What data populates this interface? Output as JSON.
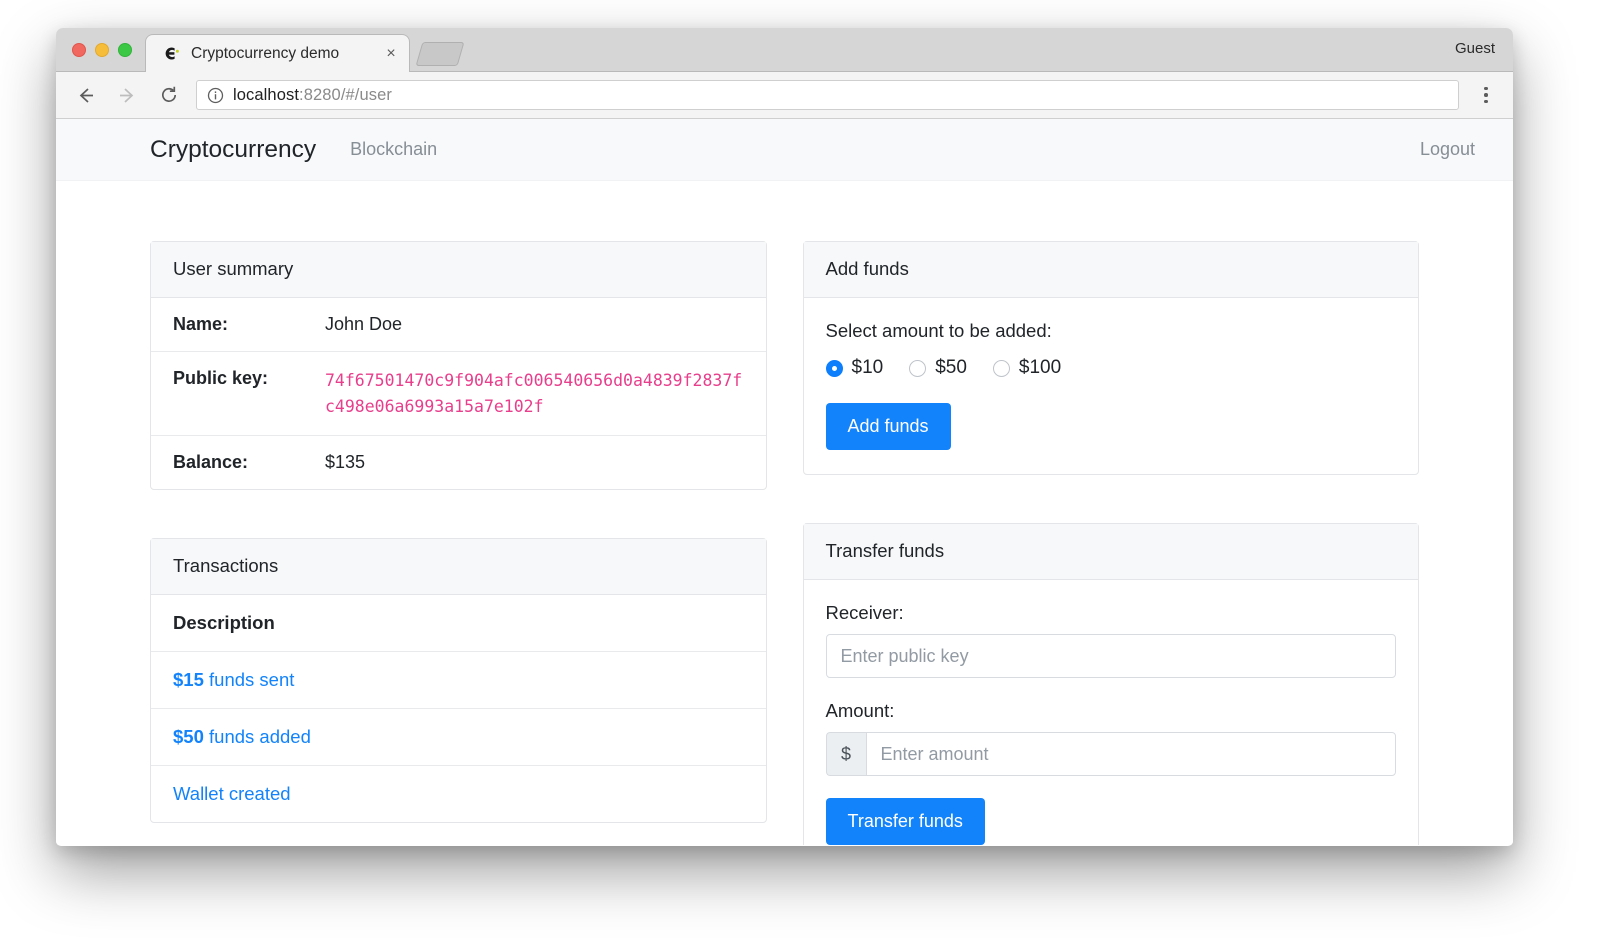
{
  "browser": {
    "tab_title": "Cryptocurrency demo",
    "favicon": "coin-c-icon",
    "close_tab": "×",
    "new_tab": "new-tab-button",
    "profile_label": "Guest",
    "back": "←",
    "forward": "→",
    "reload": "↻",
    "url_host": "localhost",
    "url_rest": ":8280/#/user",
    "menu": "browser-menu"
  },
  "navbar": {
    "brand": "Cryptocurrency",
    "links": [
      {
        "label": "Blockchain"
      }
    ],
    "logout": "Logout"
  },
  "user_summary": {
    "title": "User summary",
    "rows": [
      {
        "label": "Name:",
        "value": "John Doe"
      },
      {
        "label": "Public key:",
        "value": "74f67501470c9f904afc006540656d0a4839f2837fc498e06a6993a15a7e102f"
      },
      {
        "label": "Balance:",
        "value": "$135"
      }
    ]
  },
  "add_funds": {
    "title": "Add funds",
    "prompt": "Select amount to be added:",
    "options": [
      {
        "label": "$10",
        "selected": true
      },
      {
        "label": "$50",
        "selected": false
      },
      {
        "label": "$100",
        "selected": false
      }
    ],
    "button": "Add funds"
  },
  "transactions": {
    "title": "Transactions",
    "column": "Description",
    "rows": [
      {
        "amount": "$15",
        "text": " funds sent"
      },
      {
        "amount": "$50",
        "text": " funds added"
      },
      {
        "amount": "",
        "text": "Wallet created"
      }
    ]
  },
  "transfer_funds": {
    "title": "Transfer funds",
    "receiver_label": "Receiver:",
    "receiver_placeholder": "Enter public key",
    "receiver_value": "",
    "amount_label": "Amount:",
    "amount_prefix": "$",
    "amount_placeholder": "Enter amount",
    "amount_value": "",
    "button": "Transfer funds"
  },
  "colors": {
    "accent": "#1283fa",
    "pubkey": "#e83e8c",
    "navbar_bg": "#f8f9fa",
    "card_header_bg": "#f7f8f9"
  }
}
